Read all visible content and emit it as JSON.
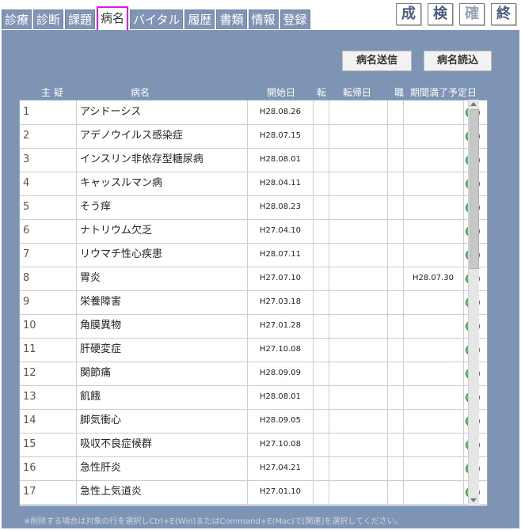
{
  "tabs": [
    "診療",
    "診断",
    "課題",
    "病名",
    "バイタル",
    "履歴",
    "書類",
    "情報",
    "登録"
  ],
  "top_buttons": [
    {
      "label": "成",
      "disabled": false
    },
    {
      "label": "検",
      "disabled": false
    },
    {
      "label": "確",
      "disabled": true
    },
    {
      "label": "終",
      "disabled": false
    }
  ],
  "actions": {
    "send": "病名送信",
    "read": "病名読込"
  },
  "headers": {
    "main_doubt": "主 疑",
    "disease": "病名",
    "start": "開始日",
    "transfer": "転",
    "outcome_date": "転帰日",
    "occupation": "職",
    "expire_date": "期間満了予定日"
  },
  "rows": [
    {
      "no": "1",
      "name": "アシドーシス",
      "start": "H28.08.26",
      "end": ""
    },
    {
      "no": "2",
      "name": "アデノウイルス感染症",
      "start": "H28.07.15",
      "end": ""
    },
    {
      "no": "3",
      "name": "インスリン非依存型糖尿病",
      "start": "H28.08.01",
      "end": ""
    },
    {
      "no": "4",
      "name": "キャッスルマン病",
      "start": "H28.04.11",
      "end": ""
    },
    {
      "no": "5",
      "name": "そう痒",
      "start": "H28.08.23",
      "end": ""
    },
    {
      "no": "6",
      "name": "ナトリウム欠乏",
      "start": "H27.04.10",
      "end": ""
    },
    {
      "no": "7",
      "name": "リウマチ性心疾患",
      "start": "H28.07.11",
      "end": ""
    },
    {
      "no": "8",
      "name": "胃炎",
      "start": "H27.07.10",
      "end": "H28.07.30"
    },
    {
      "no": "9",
      "name": "栄養障害",
      "start": "H27.03.18",
      "end": ""
    },
    {
      "no": "10",
      "name": "角膜異物",
      "start": "H27.01.28",
      "end": ""
    },
    {
      "no": "11",
      "name": "肝硬変症",
      "start": "H27.10.08",
      "end": ""
    },
    {
      "no": "12",
      "name": "関節痛",
      "start": "H28.09.09",
      "end": ""
    },
    {
      "no": "13",
      "name": "飢餓",
      "start": "H28.08.01",
      "end": ""
    },
    {
      "no": "14",
      "name": "脚気衝心",
      "start": "H28.09.05",
      "end": ""
    },
    {
      "no": "15",
      "name": "吸収不良症候群",
      "start": "H27.10.08",
      "end": ""
    },
    {
      "no": "16",
      "name": "急性肝炎",
      "start": "H27.04.21",
      "end": ""
    },
    {
      "no": "17",
      "name": "急性上気道炎",
      "start": "H27.01.10",
      "end": ""
    }
  ],
  "note": "※削除する場合は対象の行を選択しCtrl+E(Win)またはCommand+E(Mac)で[関連]を選択してください。"
}
